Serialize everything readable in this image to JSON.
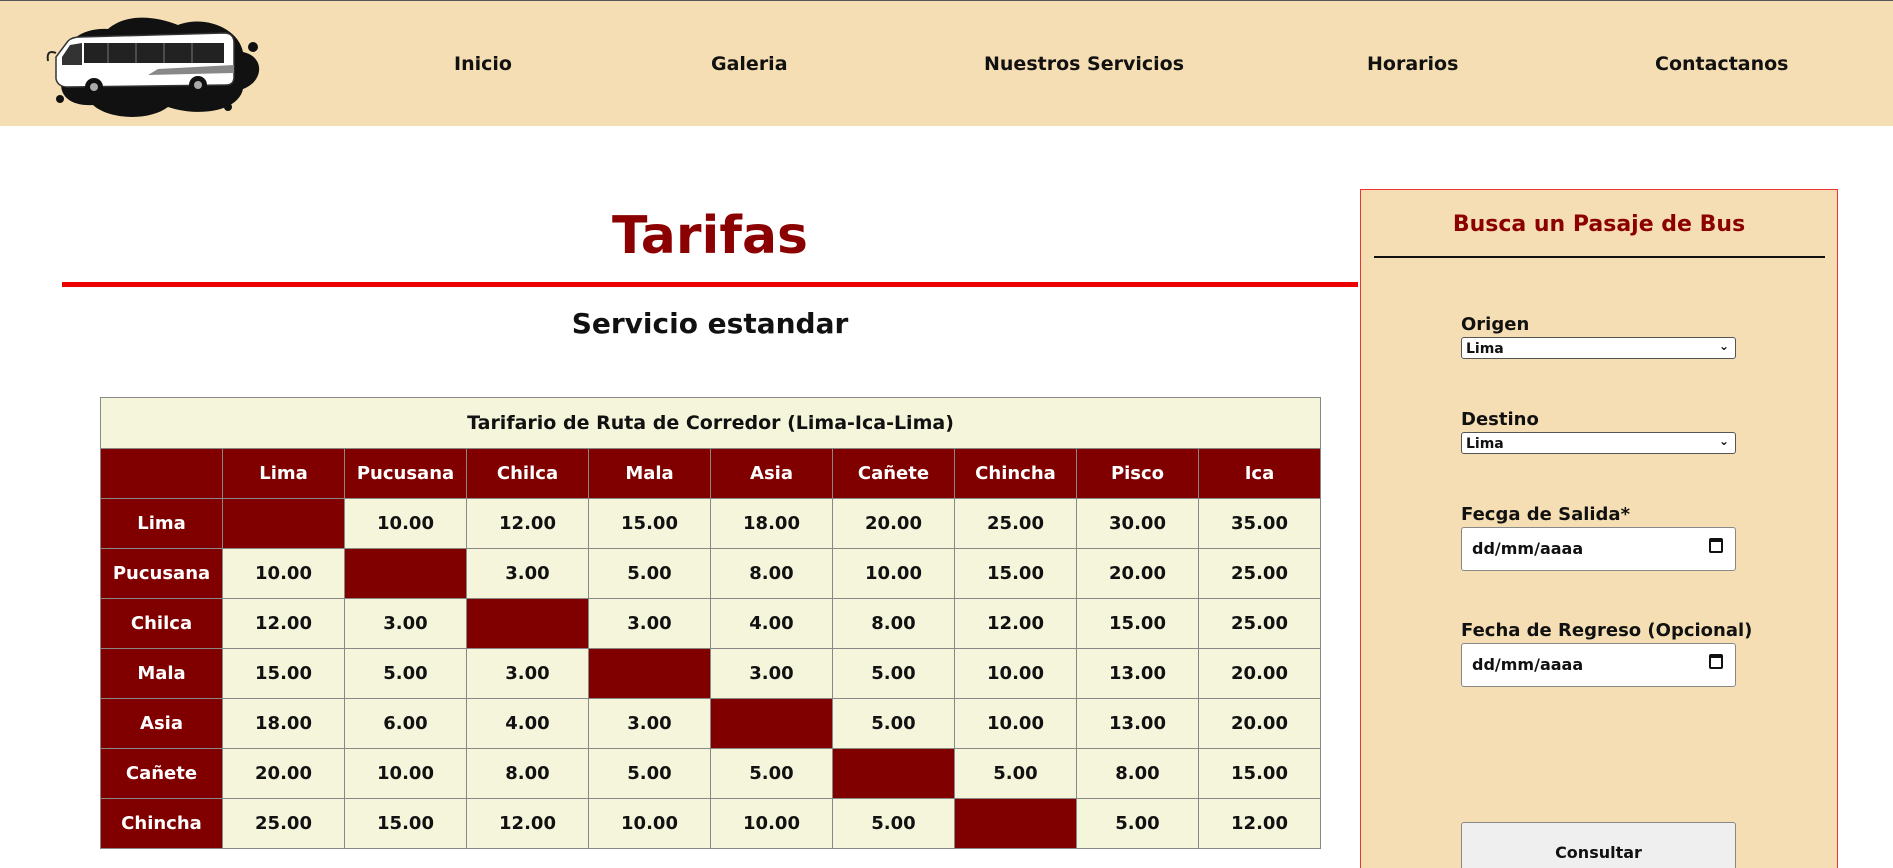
{
  "header": {
    "logo_alt": "bus-logo",
    "nav": [
      {
        "label": "Inicio"
      },
      {
        "label": "Galeria"
      },
      {
        "label": "Nuestros Servicios"
      },
      {
        "label": "Horarios"
      },
      {
        "label": "Contactanos"
      }
    ]
  },
  "main": {
    "title": "Tarifas",
    "subtitle": "Servicio estandar",
    "table": {
      "caption": "Tarifario de Ruta de Corredor (Lima-Ica-Lima)",
      "columns": [
        "Lima",
        "Pucusana",
        "Chilca",
        "Mala",
        "Asia",
        "Cañete",
        "Chincha",
        "Pisco",
        "Ica"
      ],
      "rows": [
        {
          "name": "Lima",
          "values": [
            "",
            "10.00",
            "12.00",
            "15.00",
            "18.00",
            "20.00",
            "25.00",
            "30.00",
            "35.00"
          ]
        },
        {
          "name": "Pucusana",
          "values": [
            "10.00",
            "",
            "3.00",
            "5.00",
            "8.00",
            "10.00",
            "15.00",
            "20.00",
            "25.00"
          ]
        },
        {
          "name": "Chilca",
          "values": [
            "12.00",
            "3.00",
            "",
            "3.00",
            "4.00",
            "8.00",
            "12.00",
            "15.00",
            "25.00"
          ]
        },
        {
          "name": "Mala",
          "values": [
            "15.00",
            "5.00",
            "3.00",
            "",
            "3.00",
            "5.00",
            "10.00",
            "13.00",
            "20.00"
          ]
        },
        {
          "name": "Asia",
          "values": [
            "18.00",
            "6.00",
            "4.00",
            "3.00",
            "",
            "5.00",
            "10.00",
            "13.00",
            "20.00"
          ]
        },
        {
          "name": "Cañete",
          "values": [
            "20.00",
            "10.00",
            "8.00",
            "5.00",
            "5.00",
            "",
            "5.00",
            "8.00",
            "15.00"
          ]
        },
        {
          "name": "Chincha",
          "values": [
            "25.00",
            "15.00",
            "12.00",
            "10.00",
            "10.00",
            "5.00",
            "",
            "5.00",
            "12.00"
          ]
        }
      ]
    }
  },
  "sidebar": {
    "title": "Busca un Pasaje de Bus",
    "origin_label": "Origen",
    "origin_value": "Lima",
    "destination_label": "Destino",
    "destination_value": "Lima",
    "departure_label": "Fecga de Salida*",
    "departure_placeholder": "dd/mm/aaaa",
    "return_label": "Fecha de Regreso (Opcional)",
    "return_placeholder": "dd/mm/aaaa",
    "submit_label": "Consultar"
  },
  "colors": {
    "header_bg": "#f5deb3",
    "accent": "#800000",
    "rule": "#ee0000",
    "cell_bg": "#f5f5dc"
  }
}
